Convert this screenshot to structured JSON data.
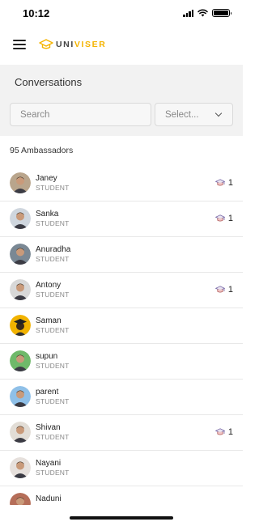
{
  "status_bar": {
    "time": "10:12"
  },
  "brand": {
    "prefix": "UNI",
    "suffix": "VISER",
    "accent_color": "#f5b400"
  },
  "conversations": {
    "title": "Conversations",
    "search_placeholder": "Search",
    "select_placeholder": "Select...",
    "count_label": "95 Ambassadors"
  },
  "ambassadors": [
    {
      "name": "Janey",
      "role": "STUDENT",
      "badge": "1",
      "avatar_bg": "#b9a58c",
      "avatar_icon": "avatar-photo-icon"
    },
    {
      "name": "Sanka",
      "role": "STUDENT",
      "badge": "1",
      "avatar_bg": "#cfd6de",
      "avatar_icon": "avatar-photo-icon"
    },
    {
      "name": "Anuradha",
      "role": "STUDENT",
      "badge": "",
      "avatar_bg": "#7a8894",
      "avatar_icon": "avatar-photo-icon"
    },
    {
      "name": "Antony",
      "role": "STUDENT",
      "badge": "1",
      "avatar_bg": "#d8d8d8",
      "avatar_icon": "avatar-photo-icon"
    },
    {
      "name": "Saman",
      "role": "STUDENT",
      "badge": "",
      "avatar_bg": "#f2b300",
      "avatar_icon": "graduate-icon"
    },
    {
      "name": "supun",
      "role": "STUDENT",
      "badge": "",
      "avatar_bg": "#6fb96a",
      "avatar_icon": "avatar-photo-icon"
    },
    {
      "name": "parent",
      "role": "STUDENT",
      "badge": "",
      "avatar_bg": "#8fc0e8",
      "avatar_icon": "avatar-photo-icon"
    },
    {
      "name": "Shivan",
      "role": "STUDENT",
      "badge": "1",
      "avatar_bg": "#e2ddd6",
      "avatar_icon": "avatar-photo-icon"
    },
    {
      "name": "Nayani",
      "role": "STUDENT",
      "badge": "",
      "avatar_bg": "#e6e0dc",
      "avatar_icon": "avatar-photo-icon"
    },
    {
      "name": "Naduni",
      "role": "STUDENT",
      "badge": "",
      "avatar_bg": "#b56e59",
      "avatar_icon": "avatar-photo-icon"
    }
  ],
  "badge_icon": "graduation-cap-icon"
}
